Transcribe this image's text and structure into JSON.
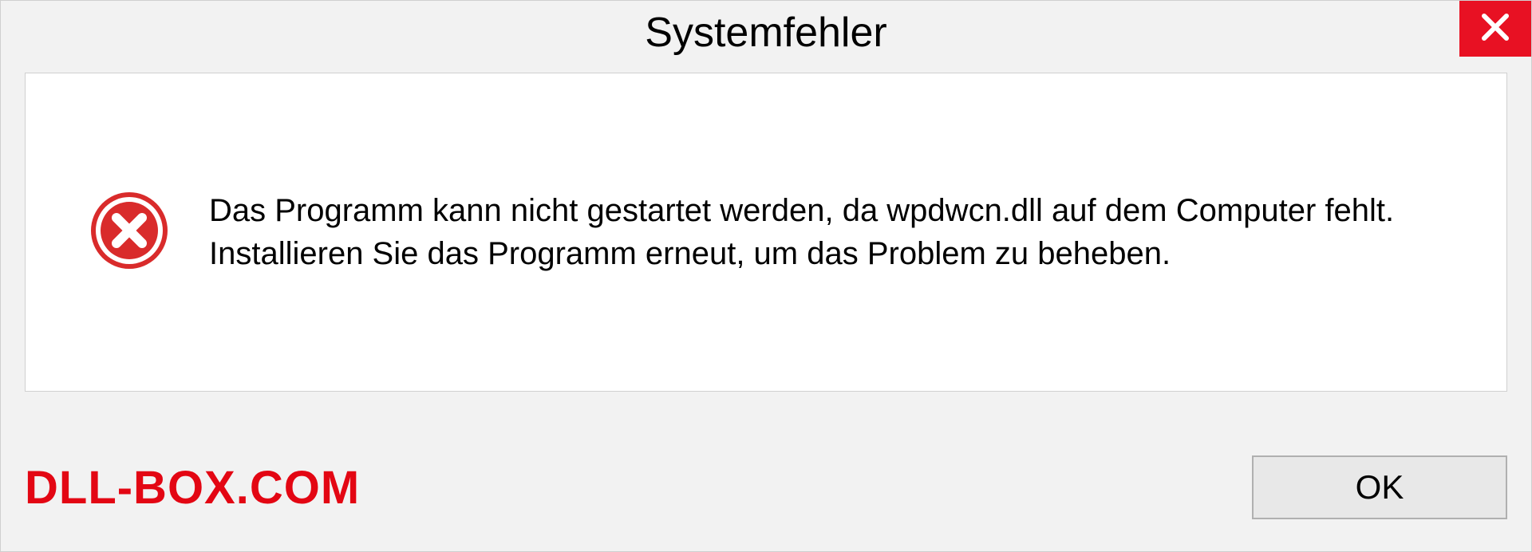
{
  "dialog": {
    "title": "Systemfehler",
    "message": "Das Programm kann nicht gestartet werden, da wpdwcn.dll auf dem Computer fehlt. Installieren Sie das Programm erneut, um das Problem zu beheben.",
    "ok_label": "OK"
  },
  "watermark": {
    "text": "DLL-BOX.COM"
  },
  "colors": {
    "close_bg": "#e81123",
    "error_icon": "#d92b2b",
    "watermark": "#e30613"
  }
}
